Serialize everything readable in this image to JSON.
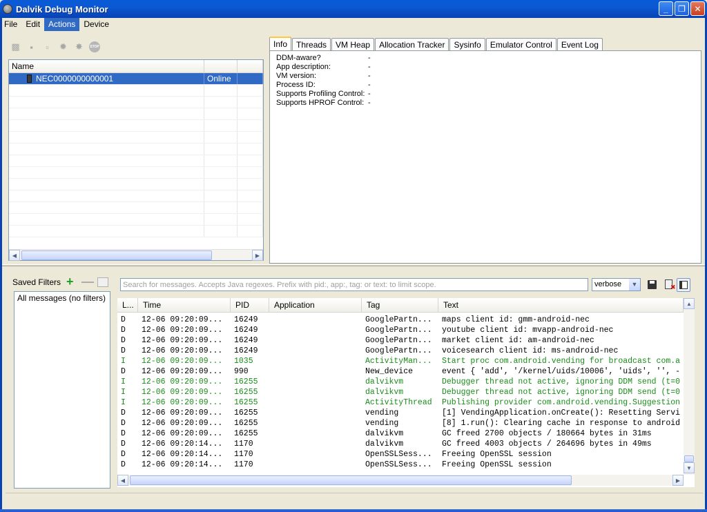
{
  "window": {
    "title": "Dalvik Debug Monitor",
    "controls": [
      "_",
      "❐",
      "✕"
    ]
  },
  "menu": [
    {
      "label": "File",
      "active": false
    },
    {
      "label": "Edit",
      "active": false
    },
    {
      "label": "Actions",
      "active": true
    },
    {
      "label": "Device",
      "active": false
    }
  ],
  "devices": {
    "toolbar_icons": [
      "debug-icon",
      "update-heap-icon",
      "dump-hprof-icon",
      "cause-gc-icon",
      "update-threads-icon",
      "stop-process-icon"
    ],
    "stop_label": "STOP",
    "columns": [
      "Name",
      "",
      ""
    ],
    "rows": [
      {
        "name": "NEC0000000000001",
        "status": "Online",
        "selected": true
      }
    ]
  },
  "info_panel": {
    "tabs": [
      "Info",
      "Threads",
      "VM Heap",
      "Allocation Tracker",
      "Sysinfo",
      "Emulator Control",
      "Event Log"
    ],
    "active_tab": "Info",
    "rows": [
      {
        "label": "DDM-aware?",
        "value": "-"
      },
      {
        "label": "App description:",
        "value": "-"
      },
      {
        "label": "VM version:",
        "value": "-"
      },
      {
        "label": "Process ID:",
        "value": "-"
      },
      {
        "label": "Supports Profiling Control:",
        "value": "-"
      },
      {
        "label": "Supports HPROF Control:",
        "value": "-"
      }
    ]
  },
  "filters": {
    "title": "Saved Filters",
    "add_label": "+",
    "remove_label": "—",
    "items": [
      "All messages (no filters)"
    ]
  },
  "logcat": {
    "search_placeholder": "Search for messages. Accepts Java regexes. Prefix with pid:, app:, tag: or text: to limit scope.",
    "level": "verbose",
    "columns": [
      "L...",
      "Time",
      "PID",
      "Application",
      "Tag",
      "Text"
    ],
    "rows": [
      {
        "level": "D",
        "time": "12-06 09:20:09...",
        "pid": "16249",
        "app": "",
        "tag": "GooglePartn...",
        "text": "maps client id: gmm-android-nec"
      },
      {
        "level": "D",
        "time": "12-06 09:20:09...",
        "pid": "16249",
        "app": "",
        "tag": "GooglePartn...",
        "text": "youtube client id: mvapp-android-nec"
      },
      {
        "level": "D",
        "time": "12-06 09:20:09...",
        "pid": "16249",
        "app": "",
        "tag": "GooglePartn...",
        "text": "market client id: am-android-nec"
      },
      {
        "level": "D",
        "time": "12-06 09:20:09...",
        "pid": "16249",
        "app": "",
        "tag": "GooglePartn...",
        "text": "voicesearch client id: ms-android-nec"
      },
      {
        "level": "I",
        "time": "12-06 09:20:09...",
        "pid": "1035",
        "app": "",
        "tag": "ActivityMan...",
        "text": "Start proc com.android.vending for broadcast com.a"
      },
      {
        "level": "D",
        "time": "12-06 09:20:09...",
        "pid": "990",
        "app": "",
        "tag": "New_device",
        "text": "event { 'add', '/kernel/uids/10006', 'uids', '', -"
      },
      {
        "level": "I",
        "time": "12-06 09:20:09...",
        "pid": "16255",
        "app": "",
        "tag": "dalvikvm",
        "text": "Debugger thread not active, ignoring DDM send (t=0"
      },
      {
        "level": "I",
        "time": "12-06 09:20:09...",
        "pid": "16255",
        "app": "",
        "tag": "dalvikvm",
        "text": "Debugger thread not active, ignoring DDM send (t=0"
      },
      {
        "level": "I",
        "time": "12-06 09:20:09...",
        "pid": "16255",
        "app": "",
        "tag": "ActivityThread",
        "text": "Publishing provider com.android.vending.Suggestion"
      },
      {
        "level": "D",
        "time": "12-06 09:20:09...",
        "pid": "16255",
        "app": "",
        "tag": "vending",
        "text": "[1] VendingApplication.onCreate(): Resetting Servi"
      },
      {
        "level": "D",
        "time": "12-06 09:20:09...",
        "pid": "16255",
        "app": "",
        "tag": "vending",
        "text": "[8] 1.run(): Clearing cache in response to android"
      },
      {
        "level": "D",
        "time": "12-06 09:20:09...",
        "pid": "16255",
        "app": "",
        "tag": "dalvikvm",
        "text": "GC freed 2700 objects / 180664 bytes in 31ms"
      },
      {
        "level": "D",
        "time": "12-06 09:20:14...",
        "pid": "1170",
        "app": "",
        "tag": "dalvikvm",
        "text": "GC freed 4003 objects / 264696 bytes in 49ms"
      },
      {
        "level": "D",
        "time": "12-06 09:20:14...",
        "pid": "1170",
        "app": "",
        "tag": "OpenSSLSess...",
        "text": "Freeing OpenSSL session"
      },
      {
        "level": "D",
        "time": "12-06 09:20:14...",
        "pid": "1170",
        "app": "",
        "tag": "OpenSSLSess...",
        "text": "Freeing OpenSSL session"
      }
    ]
  },
  "colors": {
    "title_bar": "#0b58d3",
    "selection": "#316ac5",
    "info_level_text": "#1a8c1a"
  }
}
